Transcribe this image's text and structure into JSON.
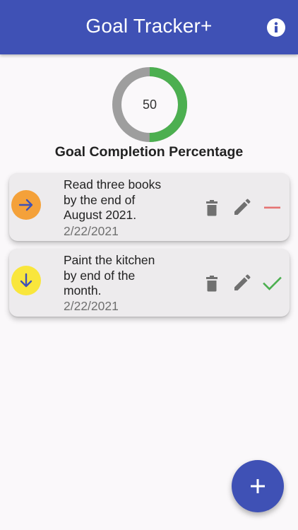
{
  "appbar": {
    "title": "Goal Tracker+",
    "info_icon": "info-icon"
  },
  "progress": {
    "value_label": "50",
    "percent": 50,
    "caption": "Goal Completion Percentage"
  },
  "colors": {
    "primary": "#3f51b5",
    "progress_fill": "#4caf50",
    "progress_track": "#9e9e9e",
    "priority_high": "#f4a13a",
    "priority_medium": "#f9e63c",
    "status_incomplete": "#e57373",
    "status_complete": "#4caf50"
  },
  "goals": [
    {
      "lines": [
        "Read three books",
        "by the end of",
        "August 2021."
      ],
      "date": "2/22/2021",
      "priority_icon": "arrow-right-icon",
      "status_icon": "minus-icon"
    },
    {
      "lines": [
        "Paint the kitchen",
        "by end of the",
        "month."
      ],
      "date": "2/22/2021",
      "priority_icon": "arrow-down-icon",
      "status_icon": "check-icon"
    }
  ],
  "fab": {
    "icon": "plus-icon"
  }
}
